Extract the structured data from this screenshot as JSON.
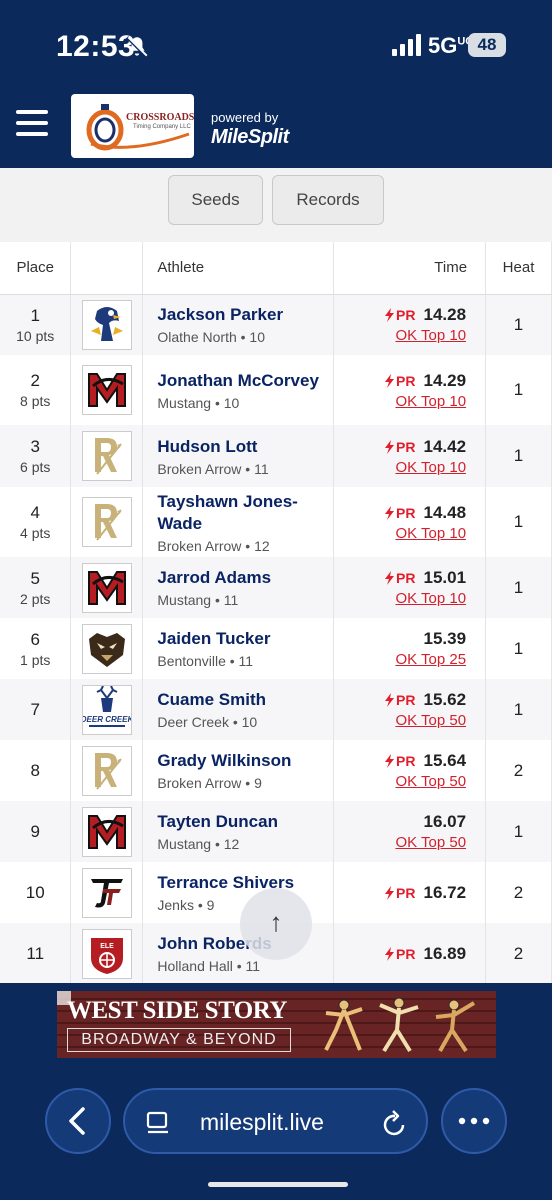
{
  "status_bar": {
    "time": "12:53",
    "network": "5G",
    "network_suffix": "UC",
    "battery": "48"
  },
  "header": {
    "logo_text": "CROSSROADS",
    "logo_subtext": "Timing Company LLC",
    "powered_by": "powered by",
    "brand": "MileSplit"
  },
  "tabs": [
    {
      "label": "Seeds"
    },
    {
      "label": "Records"
    }
  ],
  "table": {
    "headers": {
      "place": "Place",
      "athlete": "Athlete",
      "time": "Time",
      "heat": "Heat"
    },
    "pr_label": "PR",
    "rows": [
      {
        "place": "1",
        "pts": "10 pts",
        "logo": "eagle",
        "name": "Jackson Parker",
        "team": "Olathe North • 10",
        "pr": true,
        "time": "14.28",
        "rank": "OK Top 10",
        "heat": "1"
      },
      {
        "place": "2",
        "pts": "8 pts",
        "logo": "mustang",
        "name": "Jonathan McCorvey",
        "team": "Mustang • 10",
        "pr": true,
        "time": "14.29",
        "rank": "OK Top 10",
        "heat": "1"
      },
      {
        "place": "3",
        "pts": "6 pts",
        "logo": "brokenarrow",
        "name": "Hudson Lott",
        "team": "Broken Arrow • 11",
        "pr": true,
        "time": "14.42",
        "rank": "OK Top 10",
        "heat": "1"
      },
      {
        "place": "4",
        "pts": "4 pts",
        "logo": "brokenarrow",
        "name": "Tayshawn Jones-Wade",
        "team": "Broken Arrow • 12",
        "pr": true,
        "time": "14.48",
        "rank": "OK Top 10",
        "heat": "1"
      },
      {
        "place": "5",
        "pts": "2 pts",
        "logo": "mustang",
        "name": "Jarrod Adams",
        "team": "Mustang • 11",
        "pr": true,
        "time": "15.01",
        "rank": "OK Top 10",
        "heat": "1"
      },
      {
        "place": "6",
        "pts": "1 pts",
        "logo": "tiger",
        "name": "Jaiden Tucker",
        "team": "Bentonville • 11",
        "pr": false,
        "time": "15.39",
        "rank": "OK Top 25",
        "heat": "1"
      },
      {
        "place": "7",
        "pts": "",
        "logo": "deercreek",
        "name": "Cuame Smith",
        "team": "Deer Creek • 10",
        "pr": true,
        "time": "15.62",
        "rank": "OK Top 50",
        "heat": "1"
      },
      {
        "place": "8",
        "pts": "",
        "logo": "brokenarrow",
        "name": "Grady Wilkinson",
        "team": "Broken Arrow • 9",
        "pr": true,
        "time": "15.64",
        "rank": "OK Top 50",
        "heat": "2"
      },
      {
        "place": "9",
        "pts": "",
        "logo": "mustang",
        "name": "Tayten Duncan",
        "team": "Mustang • 12",
        "pr": false,
        "time": "16.07",
        "rank": "OK Top 50",
        "heat": "1"
      },
      {
        "place": "10",
        "pts": "",
        "logo": "jenks",
        "name": "Terrance Shivers",
        "team": "Jenks • 9",
        "pr": true,
        "time": "16.72",
        "rank": "",
        "heat": "2"
      },
      {
        "place": "11",
        "pts": "",
        "logo": "hollandhall",
        "name": "John Roberds",
        "team": "Holland Hall • 11",
        "pr": true,
        "time": "16.89",
        "rank": "",
        "heat": "2"
      }
    ]
  },
  "scroll_top_icon": "arrow-up-icon",
  "ad": {
    "title": "WEST SIDE STORY",
    "subtitle": "BROADWAY & BEYOND"
  },
  "browser": {
    "url": "milesplit.live"
  },
  "colors": {
    "navy": "#0b2a5b",
    "link_red": "#d0222e",
    "pr_red": "#e21e2b",
    "name_blue": "#0a2463"
  }
}
